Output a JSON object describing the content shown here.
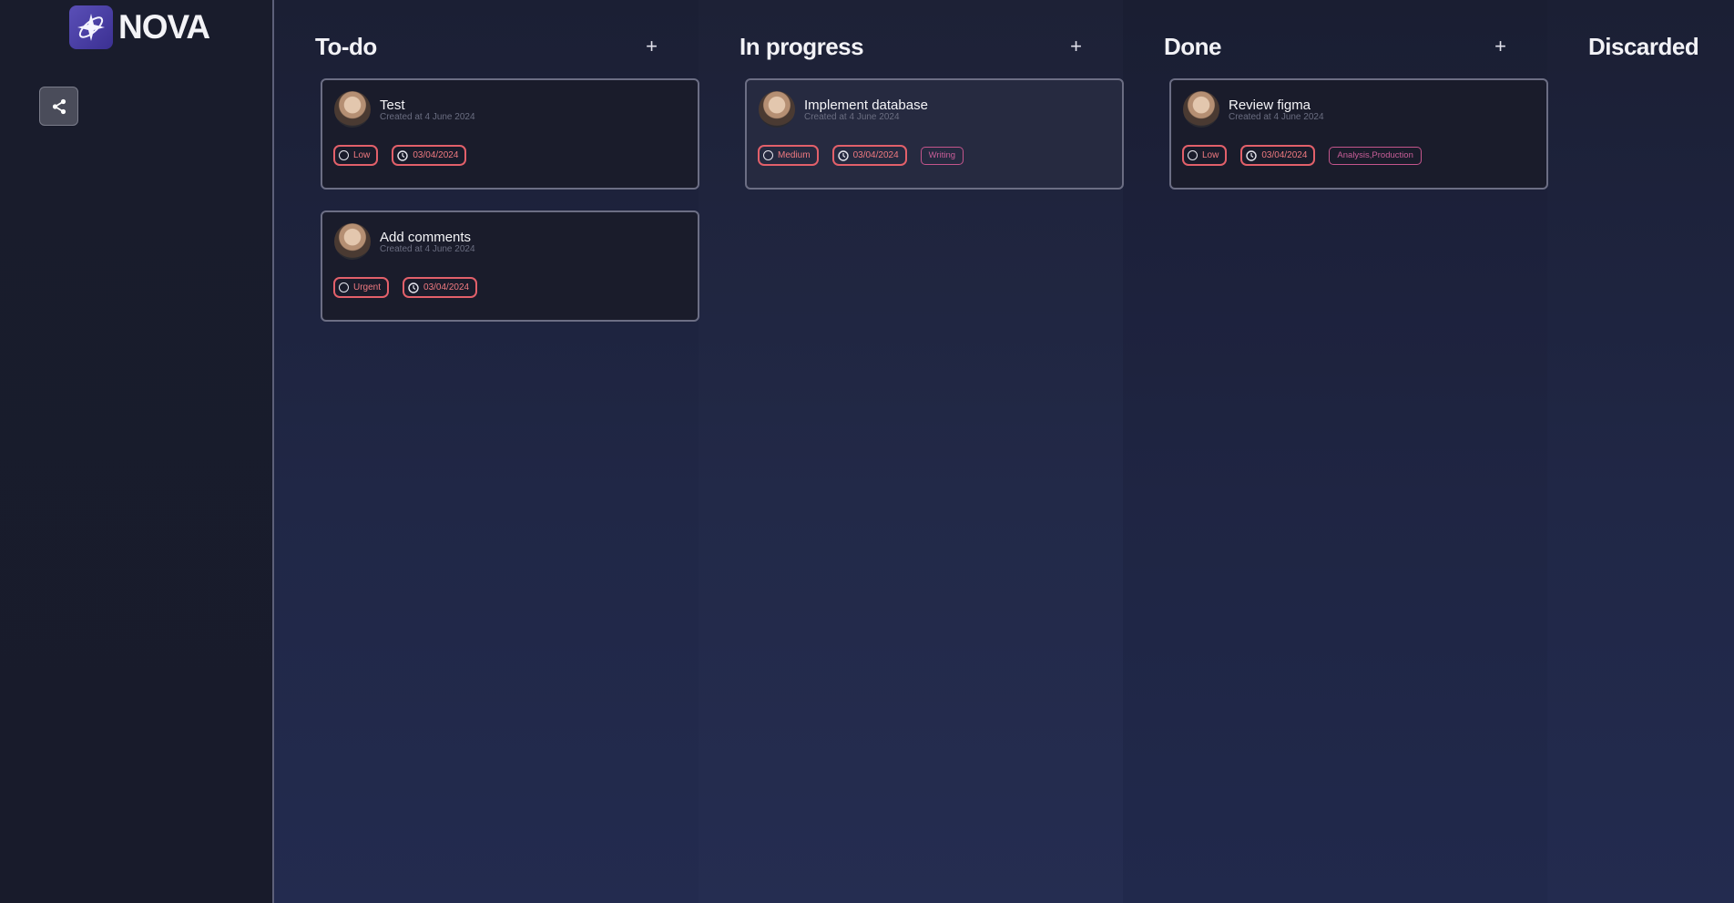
{
  "app": {
    "name": "NOVA"
  },
  "sidebar": {
    "share_icon": "share-icon"
  },
  "colors": {
    "accent": "#4a3fa6",
    "chip_border": "#e2606a",
    "tag_border": "#c4558c"
  },
  "columns": [
    {
      "title": "To-do",
      "add_label": "+",
      "cards": [
        {
          "title": "Test",
          "created": "Created at 4 June 2024",
          "priority": "Low",
          "date": "03/04/2024",
          "tag": ""
        },
        {
          "title": "Add comments",
          "created": "Created at 4 June 2024",
          "priority": "Urgent",
          "date": "03/04/2024",
          "tag": ""
        }
      ]
    },
    {
      "title": "In progress",
      "add_label": "+",
      "cards": [
        {
          "title": "Implement database",
          "created": "Created at 4 June 2024",
          "priority": "Medium",
          "date": "03/04/2024",
          "tag": "Writing"
        }
      ]
    },
    {
      "title": "Done",
      "add_label": "+",
      "cards": [
        {
          "title": "Review figma",
          "created": "Created at 4 June 2024",
          "priority": "Low",
          "date": "03/04/2024",
          "tag": "Analysis,Production"
        }
      ]
    },
    {
      "title": "Discarded",
      "add_label": "",
      "cards": []
    }
  ]
}
